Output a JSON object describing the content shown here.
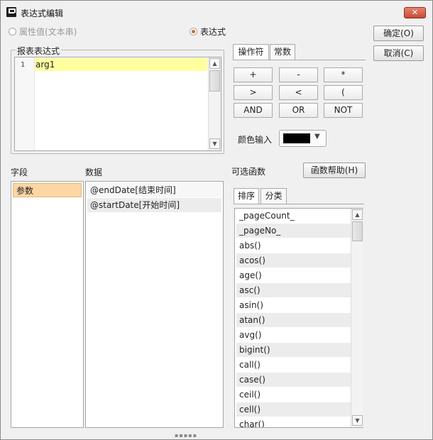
{
  "window": {
    "title": "表达式编辑",
    "close_symbol": "✕"
  },
  "mode": {
    "property_label": "属性值(文本串)",
    "expression_label": "表达式",
    "selected": "expression"
  },
  "buttons": {
    "ok": "确定(O)",
    "cancel": "取消(C)",
    "help": "函数帮助(H)"
  },
  "editor": {
    "legend": "报表表达式",
    "line_number": "1",
    "code": "arg1"
  },
  "operators": {
    "tabs": [
      "操作符",
      "常数"
    ],
    "active_tab": "操作符",
    "items": [
      "+",
      "-",
      "*",
      ">",
      "<",
      "(",
      "AND",
      "OR",
      "NOT"
    ]
  },
  "color": {
    "label": "颜色输入",
    "value": "#000000",
    "dropdown_icon": "chevron-down-icon"
  },
  "fields": {
    "header": "字段",
    "items": [
      "参数"
    ],
    "selected": "参数"
  },
  "data": {
    "header": "数据",
    "items": [
      "@endDate[结束时间]",
      "@startDate[开始时间]"
    ]
  },
  "functions": {
    "header": "可选函数",
    "tabs": [
      "排序",
      "分类"
    ],
    "active_tab": "排序",
    "items": [
      "_pageCount_",
      "_pageNo_",
      "abs()",
      "acos()",
      "age()",
      "asc()",
      "asin()",
      "atan()",
      "avg()",
      "bigint()",
      "call()",
      "case()",
      "ceil()",
      "cell()",
      "char()"
    ]
  },
  "colors": {
    "selected_field_bg": "#fcd7a4",
    "code_line_bg": "#ffffa0",
    "radio_accent": "#c96b27",
    "close_button": "#c74a32"
  }
}
